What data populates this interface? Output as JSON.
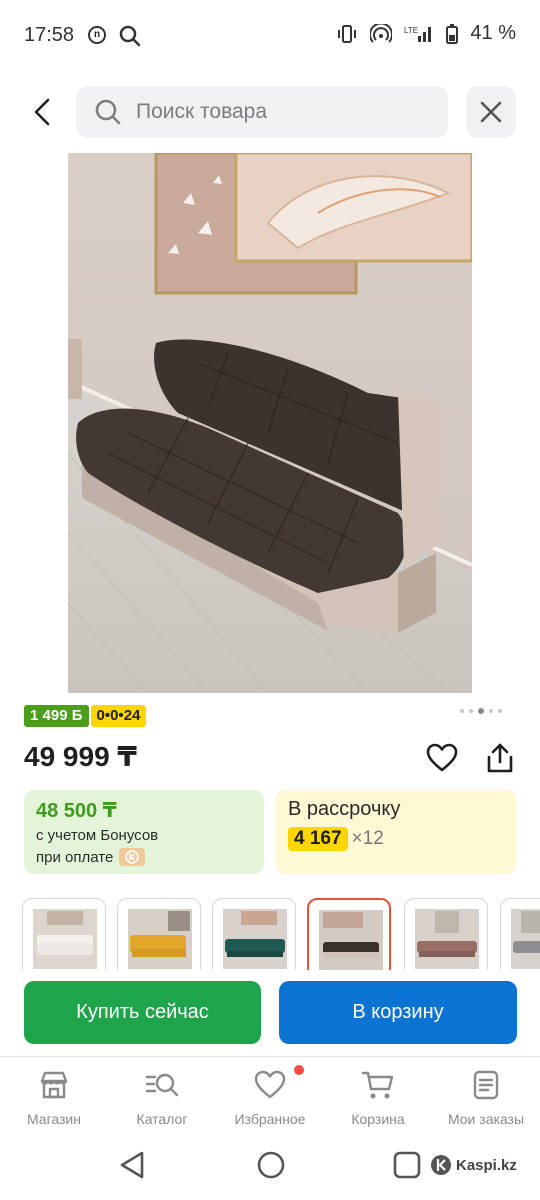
{
  "status_bar": {
    "time": "17:58",
    "notification_icon": "n",
    "network": "LTE",
    "battery": "41 %"
  },
  "search": {
    "placeholder": "Поиск товара"
  },
  "product": {
    "bonus_badge": "1 499 Б",
    "installment_badge": "0•0•24",
    "price": "49 999 ₸",
    "gallery_pages": 5,
    "gallery_active_index": 3
  },
  "bonus_card": {
    "amount": "48 500 ₸",
    "line1": "с учетом Бонусов",
    "line2": "при оплате"
  },
  "installment_card": {
    "title": "В рассрочку",
    "monthly": "4 167",
    "months": "×12"
  },
  "variants": [
    {
      "name": "white",
      "color": "#e8e4de"
    },
    {
      "name": "yellow",
      "color": "#e2a62a"
    },
    {
      "name": "green",
      "color": "#1f5a52"
    },
    {
      "name": "dark-brown",
      "color": "#3a302c",
      "selected": true
    },
    {
      "name": "rose-brown",
      "color": "#9a6e64"
    },
    {
      "name": "grey",
      "color": "#8d8f92"
    }
  ],
  "actions": {
    "buy_now": "Купить сейчас",
    "add_to_cart": "В корзину"
  },
  "bottom_nav": {
    "items": [
      {
        "label": "Магазин",
        "icon": "store-icon"
      },
      {
        "label": "Каталог",
        "icon": "catalog-search-icon"
      },
      {
        "label": "Избранное",
        "icon": "heart-icon"
      },
      {
        "label": "Корзина",
        "icon": "cart-icon"
      },
      {
        "label": "Мои заказы",
        "icon": "orders-icon"
      }
    ]
  },
  "watermark": "Kaspi.kz",
  "colors": {
    "green": "#1ea54b",
    "blue": "#0b73d1",
    "yellow": "#ffd600",
    "bonus_green": "#4a9e1c",
    "selected_border": "#e5533b"
  }
}
